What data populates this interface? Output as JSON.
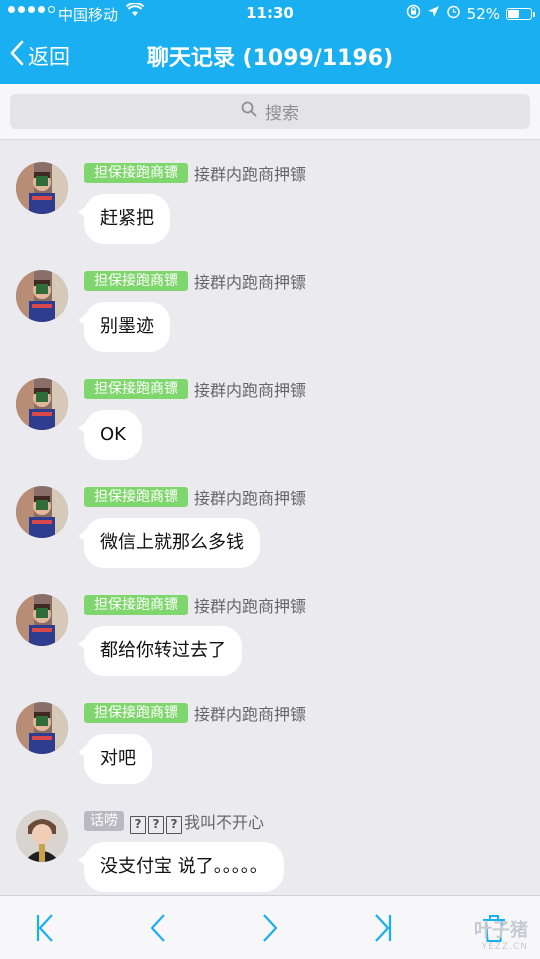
{
  "status_bar": {
    "carrier": "中国移动",
    "time": "11:30",
    "battery_text": "52%",
    "battery_level": 0.52,
    "icons": [
      "signal-dots",
      "wifi-icon",
      "rotation-lock-icon",
      "location-icon",
      "alarm-icon",
      "battery-icon"
    ]
  },
  "nav": {
    "back_label": "返回",
    "title": "聊天记录 (1099/1196)"
  },
  "search": {
    "placeholder": "搜索"
  },
  "messages": [
    {
      "tag": "担保接跑商镖",
      "sender": "接群内跑商押镖",
      "text": "赶紧把"
    },
    {
      "tag": "担保接跑商镖",
      "sender": "接群内跑商押镖",
      "text": "别墨迹"
    },
    {
      "tag": "担保接跑商镖",
      "sender": "接群内跑商押镖",
      "text": "OK"
    },
    {
      "tag": "担保接跑商镖",
      "sender": "接群内跑商押镖",
      "text": "微信上就那么多钱"
    },
    {
      "tag": "担保接跑商镖",
      "sender": "接群内跑商押镖",
      "text": "都给你转过去了"
    },
    {
      "tag": "担保接跑商镖",
      "sender": "接群内跑商押镖",
      "text": "对吧"
    },
    {
      "tag": "话唠",
      "sender_prefix": "???",
      "sender": "我叫不开心",
      "text": "没支付宝 说了。。。。。"
    }
  ],
  "toolbar": {
    "buttons": [
      "first-page",
      "previous-page",
      "next-page",
      "last-page",
      "delete"
    ],
    "accent": "#1aaff0"
  },
  "watermark": {
    "main": "叶子猪",
    "sub": "YEZZ.CN"
  },
  "colors": {
    "header": "#1aaff0",
    "tag_green": "#7ed66c",
    "tag_gray": "#b9b9bf",
    "background": "#ebebef"
  }
}
